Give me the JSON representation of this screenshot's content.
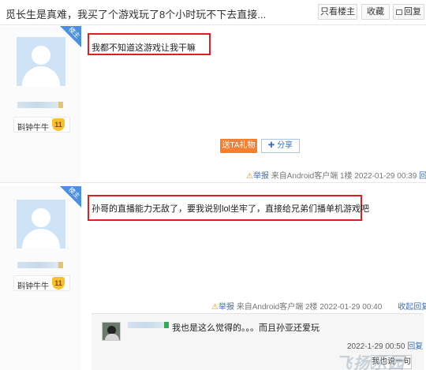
{
  "header": {
    "title": "觅长生是真难，我买了个游戏玩了8个小时玩不下去直接...",
    "buttons": [
      "只看楼主",
      "收藏",
      "回复"
    ]
  },
  "ribbon_label": "楼主",
  "posts": [
    {
      "level_name": "斟钟牛牛",
      "level": "11",
      "content": "我都不知道这游戏让我干嘛",
      "gift_label": "送TA礼物",
      "share_label": "分享",
      "meta": {
        "report": "举报",
        "source": "来自Android客户端",
        "floor": "1楼",
        "time": "2022-01-29 00:39",
        "reply": "回复"
      }
    },
    {
      "level_name": "斟钟牛牛",
      "level": "11",
      "content": "孙哥的直播能力无敌了，要我说别lol坐牢了，直接给兄弟们播单机游戏吧",
      "meta": {
        "report": "举报",
        "source": "来自Android客户端",
        "floor": "2楼",
        "time": "2022-01-29 00:40",
        "collapse": "收起回复"
      },
      "reply": {
        "text": "我也是这么觉得的。。。而且孙亚还爱玩",
        "time": "2022-1-29 00:50",
        "reply_label": "回复",
        "say_button": "我也说一句"
      }
    }
  ],
  "icons": {
    "report": "warning-icon",
    "share": "plus-icon",
    "reply_header": "comment-icon"
  },
  "colors": {
    "accent_blue": "#3b6fbf",
    "gift_orange": "#f77f2f",
    "highlight_red": "#e02020",
    "ribbon_blue": "#4a8fe0"
  }
}
